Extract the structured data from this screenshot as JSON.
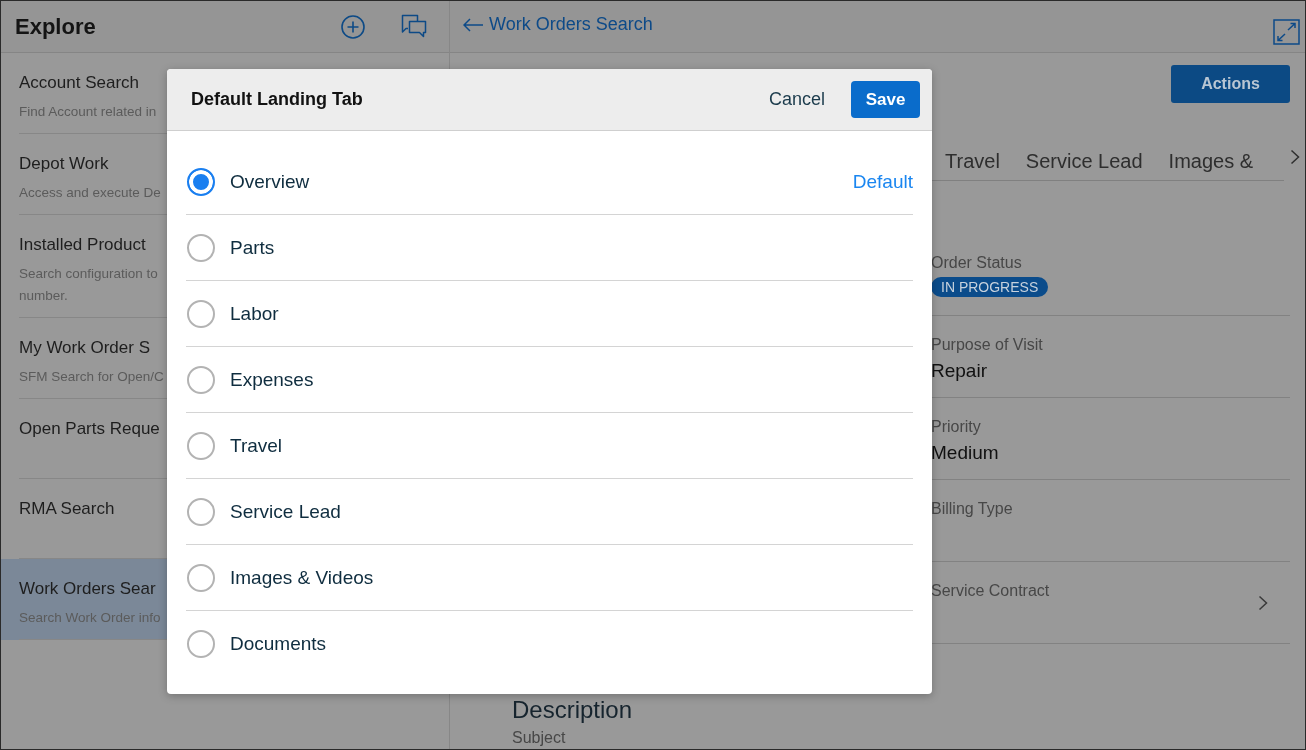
{
  "sidebar": {
    "title": "Explore",
    "items": [
      {
        "title": "Account Search",
        "description": [
          "Find Account related in"
        ],
        "selected": false
      },
      {
        "title": "Depot Work",
        "description": [
          "Access and execute De"
        ],
        "selected": false
      },
      {
        "title": "Installed Product",
        "description": [
          "Search configuration to",
          "number."
        ],
        "selected": false
      },
      {
        "title": "My Work Order S",
        "description": [
          "SFM Search for Open/C"
        ],
        "selected": false
      },
      {
        "title": "Open Parts Reque",
        "selected": false
      },
      {
        "title": "RMA Search",
        "selected": false
      },
      {
        "title": "Work Orders Sear",
        "description": [
          "Search Work Order info"
        ],
        "selected": true
      }
    ]
  },
  "main": {
    "back_link": "Work Orders Search",
    "actions_button": "Actions",
    "tabs": [
      "Travel",
      "Service Lead",
      "Images &"
    ],
    "fields": [
      {
        "kind": "badge",
        "label": "Order Status",
        "value": "IN PROGRESS"
      },
      {
        "kind": "text",
        "label": "Purpose of Visit",
        "value": "Repair"
      },
      {
        "kind": "text",
        "label": "Priority",
        "value": "Medium"
      },
      {
        "kind": "text",
        "label": "Billing Type"
      },
      {
        "kind": "link",
        "label": "Service Contract"
      }
    ],
    "section": {
      "title": "Description",
      "field_labels": [
        "Subject"
      ]
    }
  },
  "dialog": {
    "title": "Default Landing Tab",
    "cancel_button": "Cancel",
    "save_button": "Save",
    "options": [
      {
        "label": "Overview",
        "selected": true,
        "note": "Default"
      },
      {
        "label": "Parts",
        "selected": false
      },
      {
        "label": "Labor",
        "selected": false
      },
      {
        "label": "Expenses",
        "selected": false
      },
      {
        "label": "Travel",
        "selected": false
      },
      {
        "label": "Service Lead",
        "selected": false
      },
      {
        "label": "Images & Videos",
        "selected": false
      },
      {
        "label": "Documents",
        "selected": false
      }
    ]
  }
}
